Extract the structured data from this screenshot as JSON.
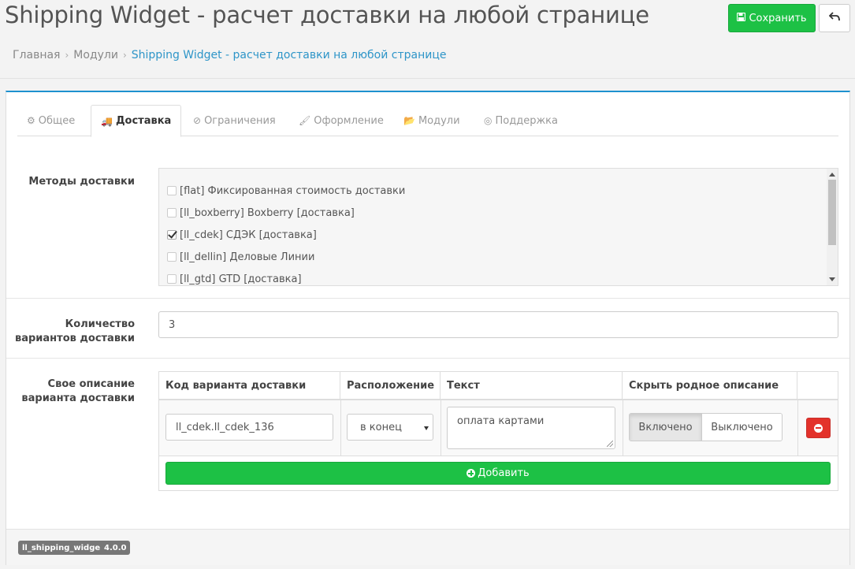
{
  "header": {
    "title": "Shipping Widget - расчет доставки на любой странице",
    "save_label": "Сохранить",
    "save_icon": "floppy-icon",
    "back_icon": "reply-icon"
  },
  "breadcrumb": {
    "items": [
      "Главная",
      "Модули",
      "Shipping Widget - расчет доставки на любой странице"
    ],
    "separator": "›"
  },
  "tabs": [
    {
      "label": "Общее",
      "icon": "⚙",
      "active": false
    },
    {
      "label": "Доставка",
      "icon": "🚚",
      "active": true
    },
    {
      "label": "Ограничения",
      "icon": "⊘",
      "active": false
    },
    {
      "label": "Оформление",
      "icon": "🖌",
      "active": false
    },
    {
      "label": "Модули",
      "icon": "📂",
      "active": false
    },
    {
      "label": "Поддержка",
      "icon": "◎",
      "active": false
    }
  ],
  "shipping_methods": {
    "label": "Методы доставки",
    "items": [
      {
        "label": "[flat] Фиксированная стоимость доставки",
        "checked": false
      },
      {
        "label": "[ll_boxberry] Boxberry [доставка]",
        "checked": false
      },
      {
        "label": "[ll_cdek] СДЭК [доставка]",
        "checked": true
      },
      {
        "label": "[ll_dellin] Деловые Линии",
        "checked": false
      },
      {
        "label": "[ll_gtd] GTD [доставка]",
        "checked": false
      }
    ]
  },
  "variant_count": {
    "label_line1": "Количество",
    "label_line2": "вариантов доставки",
    "value": "3"
  },
  "custom_description": {
    "label_line1": "Свое описание",
    "label_line2": "варианта доставки",
    "columns": [
      "Код варианта доставки",
      "Расположение",
      "Текст",
      "Скрыть родное описание"
    ],
    "rows": [
      {
        "code": "ll_cdek.ll_cdek_136",
        "position": "в конец",
        "text": "оплата картами",
        "toggle_on": "Включено",
        "toggle_off": "Выключено",
        "hide_native": true
      }
    ],
    "add_label": "Добавить"
  },
  "footer": {
    "badges": [
      "ll_shipping_widget",
      "4.0.0"
    ]
  },
  "colors": {
    "accent": "#1e91cf",
    "success": "#1dc145",
    "danger": "#e3322b",
    "link": "#2e95c8"
  }
}
